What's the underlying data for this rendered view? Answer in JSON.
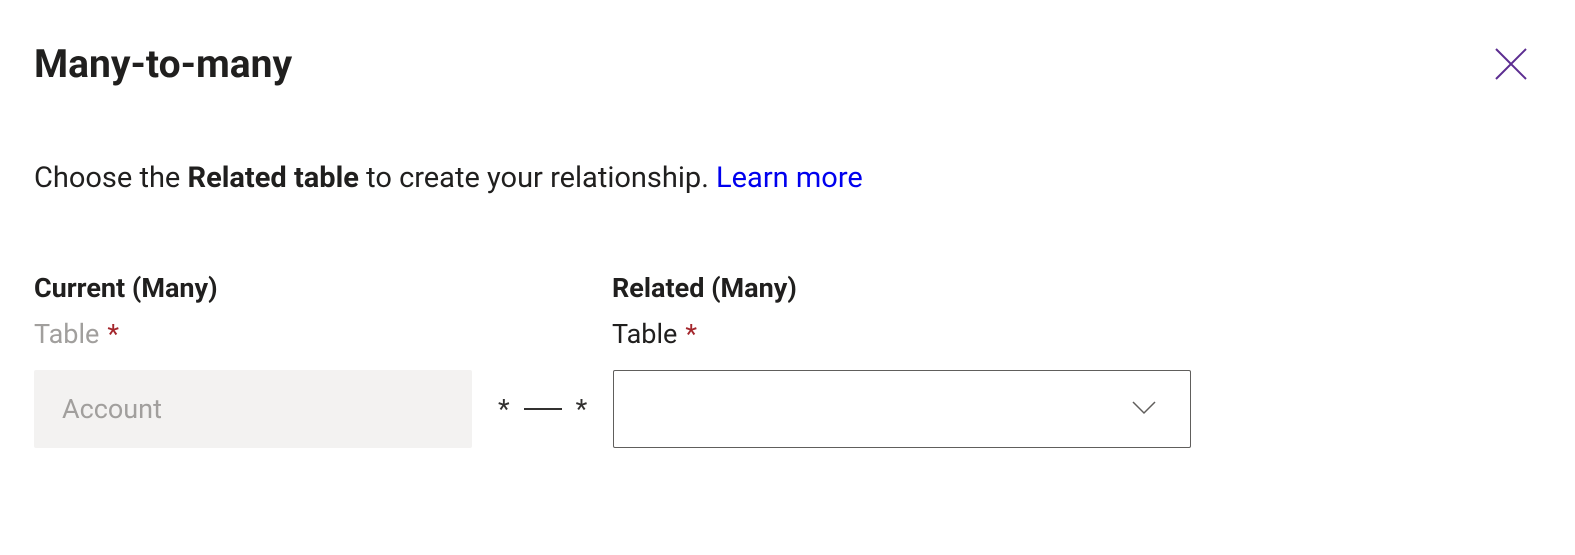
{
  "header": {
    "title": "Many-to-many"
  },
  "intro": {
    "prefix": "Choose the ",
    "bold": "Related table",
    "suffix": " to create your relationship. ",
    "learn_more": "Learn more"
  },
  "current": {
    "heading": "Current (Many)",
    "field_label": "Table",
    "required_mark": "*",
    "value": "Account"
  },
  "connector": {
    "left_symbol": "*",
    "right_symbol": "*"
  },
  "related": {
    "heading": "Related (Many)",
    "field_label": "Table",
    "required_mark": "*",
    "value": ""
  }
}
